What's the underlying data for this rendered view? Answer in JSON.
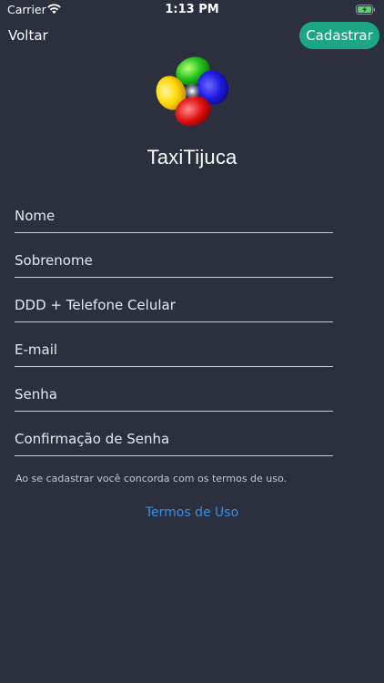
{
  "status_bar": {
    "carrier": "Carrier",
    "time": "1:13 PM"
  },
  "nav": {
    "back_label": "Voltar",
    "register_label": "Cadastrar"
  },
  "app": {
    "title": "TaxiTijuca"
  },
  "form": {
    "fields": [
      {
        "placeholder": "Nome",
        "value": ""
      },
      {
        "placeholder": "Sobrenome",
        "value": ""
      },
      {
        "placeholder": "DDD + Telefone Celular",
        "value": ""
      },
      {
        "placeholder": "E-mail",
        "value": ""
      },
      {
        "placeholder": "Senha",
        "value": ""
      },
      {
        "placeholder": "Confirmação de Senha",
        "value": ""
      }
    ]
  },
  "terms": {
    "note": "Ao se cadastrar você concorda com os termos de uso.",
    "link_label": "Termos de Uso"
  },
  "colors": {
    "background": "#2c2f3e",
    "accent_button": "#1ca684",
    "link": "#3a8dde",
    "battery": "#4cd964"
  },
  "icons": {
    "wifi": "wifi-icon",
    "battery": "battery-charging-icon",
    "logo": "taxitijuca-logo"
  }
}
